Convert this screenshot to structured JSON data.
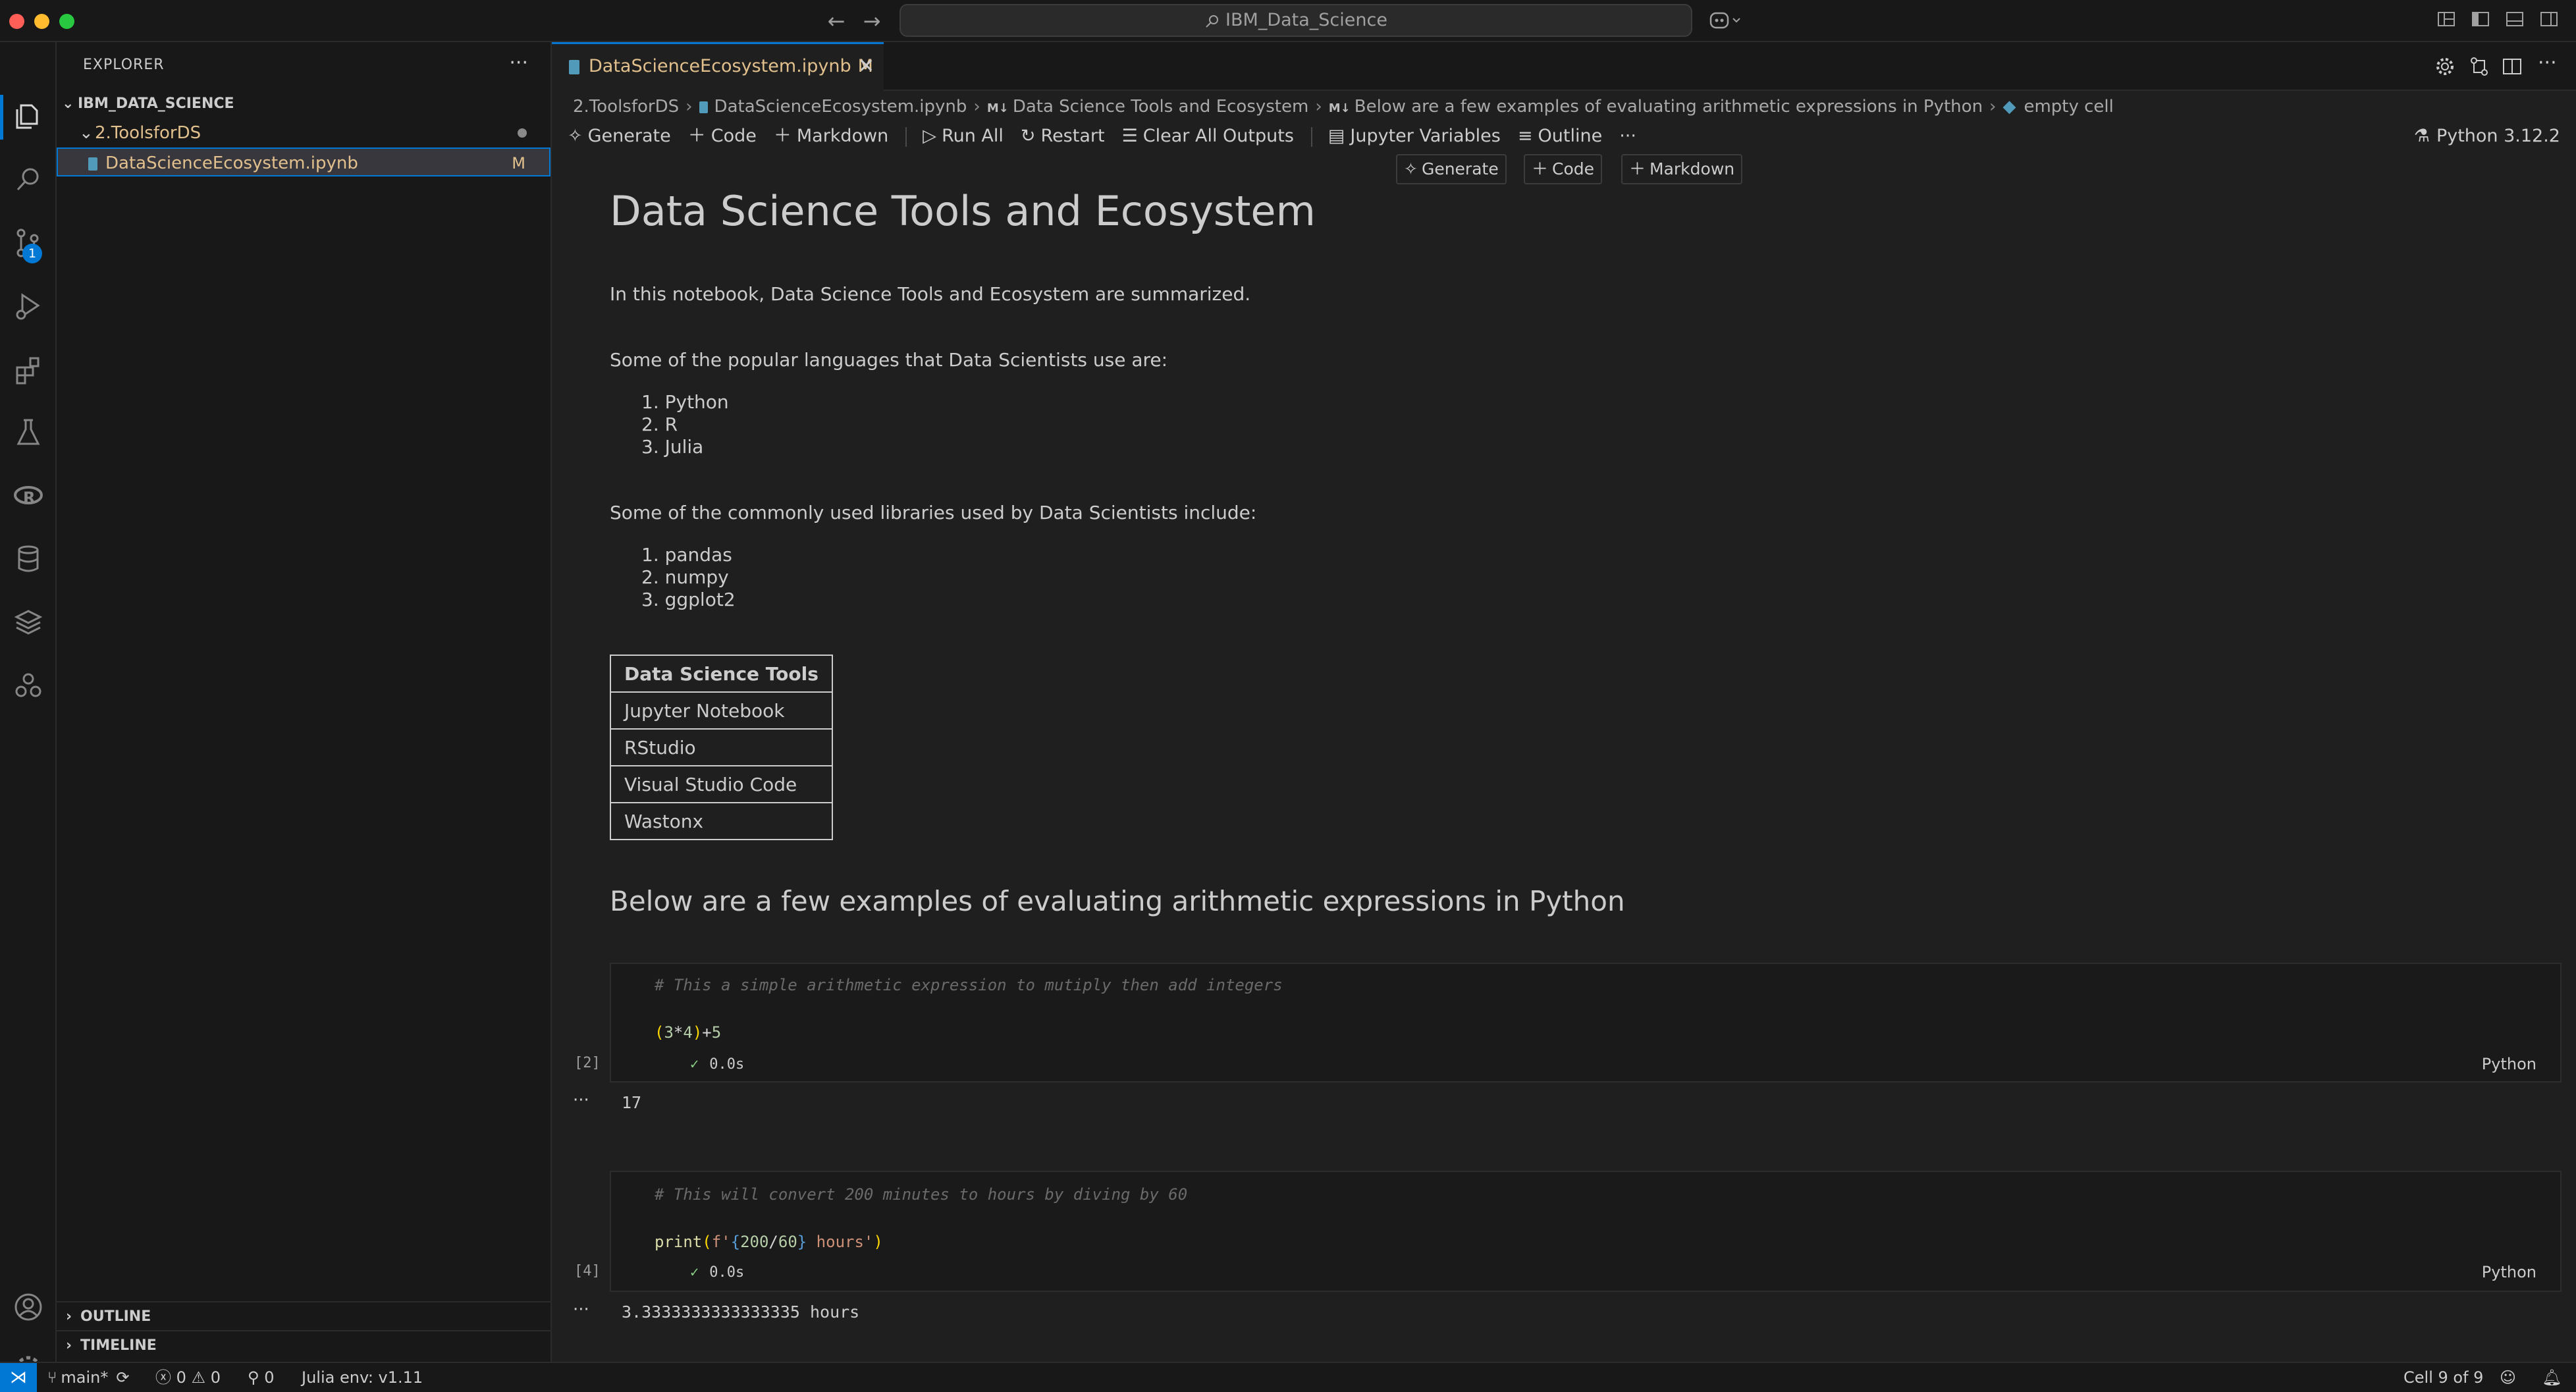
{
  "window": {
    "title": "IBM_Data_Science"
  },
  "activity_bar": {
    "scm_badge": "1"
  },
  "explorer": {
    "header": "EXPLORER",
    "more": "···",
    "root": "IBM_DATA_SCIENCE",
    "folder": "2.ToolsforDS",
    "file": "DataScienceEcosystem.ipynb",
    "file_status": "M",
    "outline": "OUTLINE",
    "timeline": "TIMELINE"
  },
  "tab": {
    "label": "DataScienceEcosystem.ipynb",
    "status": "M",
    "close": "✕"
  },
  "breadcrumb": {
    "items": [
      "2.ToolsforDS",
      "DataScienceEcosystem.ipynb",
      "Data Science Tools and Ecosystem",
      "Below are a few examples of evaluating arithmetic expressions in Python",
      "empty cell"
    ],
    "md_badge": "M↓"
  },
  "toolbar": {
    "generate": "Generate",
    "code": "Code",
    "markdown": "Markdown",
    "run_all": "Run All",
    "restart": "Restart",
    "clear_outputs": "Clear All Outputs",
    "variables": "Jupyter Variables",
    "outline": "Outline",
    "more": "···",
    "kernel": "Python 3.12.2"
  },
  "insert_bar": {
    "generate": "Generate",
    "code": "Code",
    "markdown": "Markdown"
  },
  "notebook": {
    "title": "Data Science Tools and Ecosystem",
    "intro": "In this notebook, Data Science Tools and Ecosystem are summarized.",
    "languages_intro": "Some of the popular languages that Data Scientists use are:",
    "languages": [
      "1. Python",
      "2. R",
      "3. Julia"
    ],
    "libraries_intro": "Some of the commonly used libraries used by Data Scientists include:",
    "libraries": [
      "1. pandas",
      "2. numpy",
      "3. ggplot2"
    ],
    "tools_header": "Data Science Tools",
    "tools": [
      "Jupyter Notebook",
      "RStudio",
      "Visual Studio Code",
      "Wastonx"
    ],
    "arith_heading": "Below are a few examples of evaluating arithmetic expressions in Python",
    "cells": [
      {
        "comment": "# This a simple arithmetic expression to mutiply then add integers",
        "code_tokens": [
          "(",
          "3",
          "*",
          "4",
          ")",
          "+",
          "5"
        ],
        "exec_count": "[2]",
        "time": "0.0s",
        "lang": "Python",
        "output": "17"
      },
      {
        "comment": "# This will convert 200 minutes to hours by diving by 60",
        "code_tokens": [
          "print",
          "(",
          "f'",
          "{",
          "200",
          "/",
          "60",
          "}",
          " hours'",
          ")"
        ],
        "exec_count": "[4]",
        "time": "0.0s",
        "lang": "Python",
        "output": "3.3333333333333335 hours"
      }
    ],
    "out_dots": "···"
  },
  "statusbar": {
    "branch": "main*",
    "errors": "0",
    "warnings": "0",
    "ports": "0",
    "julia": "Julia env: v1.11",
    "cell_pos": "Cell 9 of 9"
  }
}
